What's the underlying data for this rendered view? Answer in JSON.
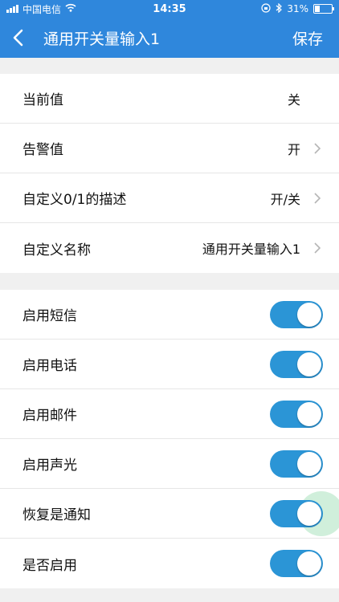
{
  "status_bar": {
    "carrier": "中国电信",
    "time": "14:35",
    "battery": "31%"
  },
  "nav": {
    "title": "通用开关量输入1",
    "save_label": "保存"
  },
  "info_rows": [
    {
      "label": "当前值",
      "value": "关"
    },
    {
      "label": "告警值",
      "value": "开"
    },
    {
      "label": "自定义0/1的描述",
      "value": "开/关"
    },
    {
      "label": "自定义名称",
      "value": "通用开关量输入1"
    }
  ],
  "toggle_rows": [
    {
      "label": "启用短信",
      "on": true
    },
    {
      "label": "启用电话",
      "on": true
    },
    {
      "label": "启用邮件",
      "on": true
    },
    {
      "label": "启用声光",
      "on": true
    },
    {
      "label": "恢复是通知",
      "on": true
    },
    {
      "label": "是否启用",
      "on": true
    }
  ],
  "colors": {
    "accent": "#2f87dc",
    "toggle_on": "#2b95d6"
  }
}
